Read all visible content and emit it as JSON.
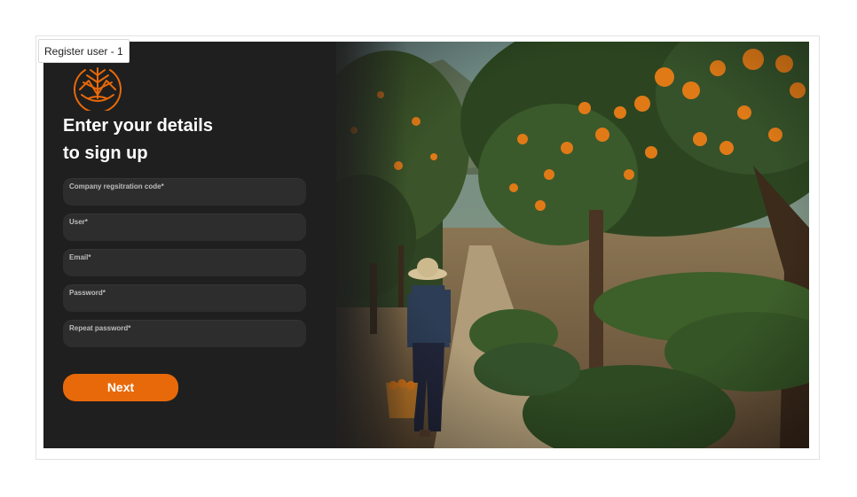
{
  "frame": {
    "label": "Register user - 1"
  },
  "brand": {
    "logo_icon": "orange-tree-logo-icon",
    "accent_color": "#e8690a"
  },
  "form": {
    "heading_line1": "Enter your details",
    "heading_line2": "to sign up",
    "fields": [
      {
        "label": "Company regsitration code*",
        "value": ""
      },
      {
        "label": "User*",
        "value": ""
      },
      {
        "label": "Email*",
        "value": ""
      },
      {
        "label": "Password*",
        "value": ""
      },
      {
        "label": "Repeat password*",
        "value": ""
      }
    ],
    "next_label": "Next"
  },
  "background": {
    "image": "orange-orchard-farmer-photo"
  }
}
